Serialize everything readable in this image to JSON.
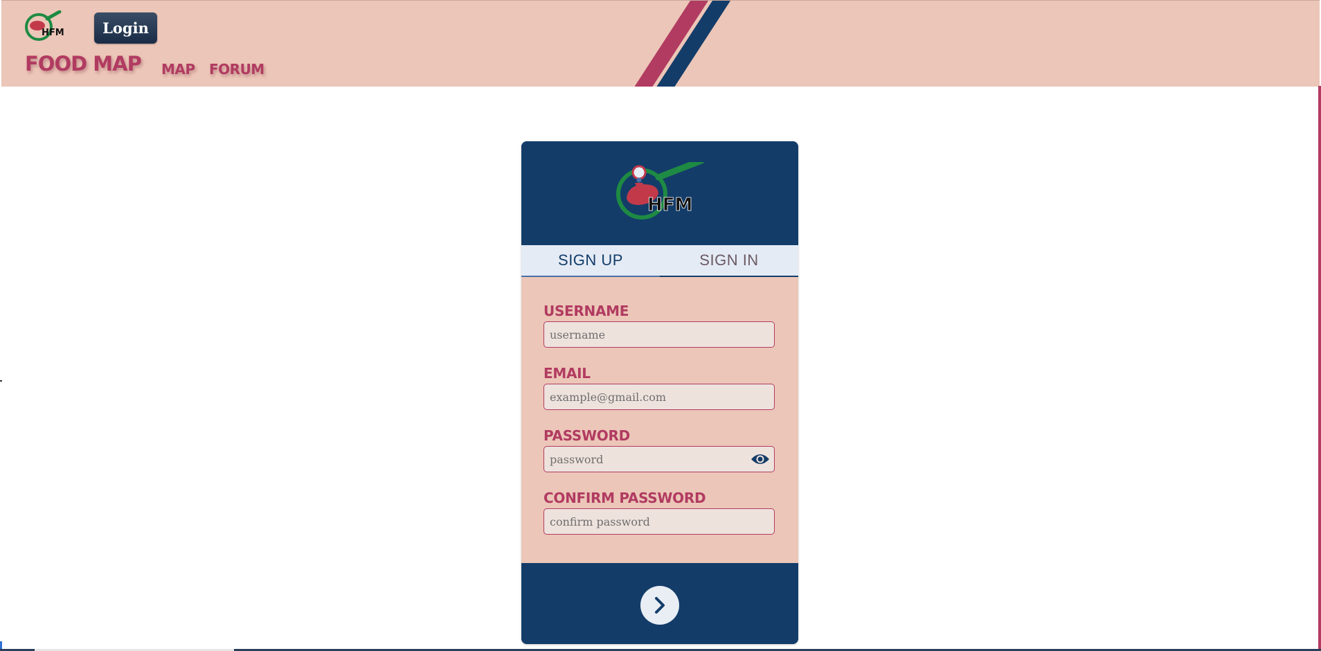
{
  "header": {
    "login_label": "Login",
    "brand": "FOOD MAP",
    "nav": {
      "map": "MAP",
      "forum": "FORUM"
    },
    "logo_text": "HFM"
  },
  "card": {
    "logo_text": "HFM",
    "tabs": [
      {
        "label": "SIGN UP",
        "active": true
      },
      {
        "label": "SIGN IN",
        "active": false
      }
    ],
    "fields": {
      "username": {
        "label": "USERNAME",
        "placeholder": "username",
        "value": ""
      },
      "email": {
        "label": "EMAIL",
        "placeholder": "example@gmail.com",
        "value": ""
      },
      "password": {
        "label": "PASSWORD",
        "placeholder": "password",
        "value": ""
      },
      "confirm": {
        "label": "CONFIRM PASSWORD",
        "placeholder": "confirm password",
        "value": ""
      }
    },
    "submit_icon": "chevron-right-icon"
  },
  "colors": {
    "navy": "#133c69",
    "accent": "#b13b61",
    "peach": "#ecc6b8",
    "tab_bg": "#e4ebf5"
  }
}
